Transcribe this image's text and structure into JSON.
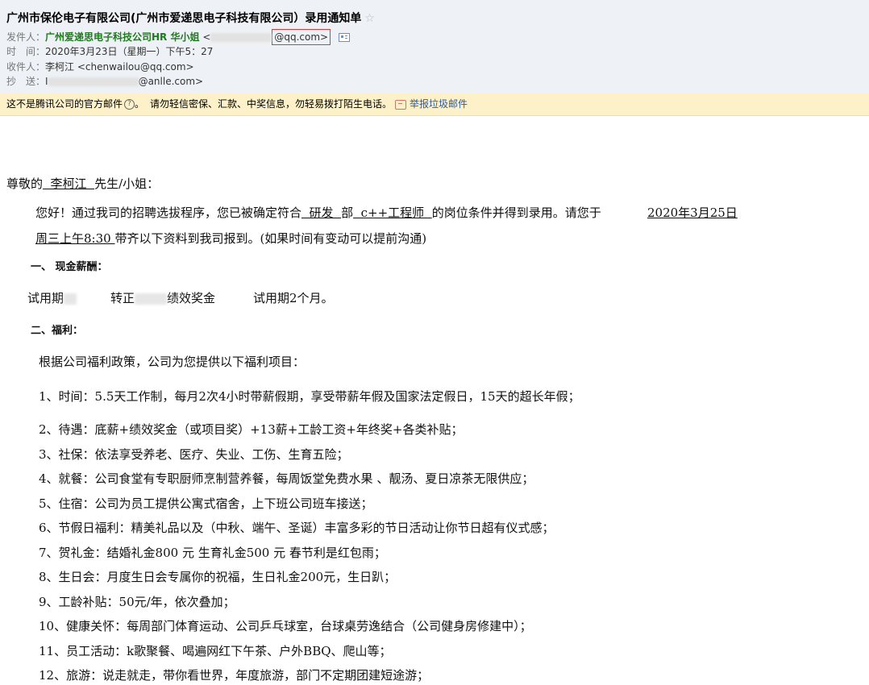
{
  "header": {
    "subject": "广州市保伦电子有限公司(广州市爱递思电子科技有限公司）录用通知单",
    "from_label": "发件人：",
    "from_name": "广州爱递思电子科技公司HR 华小姐",
    "from_email_open": "<",
    "from_email_domain": "@qq.com>",
    "time_label": "时　间：",
    "time_value": "2020年3月23日（星期一）下午5：27",
    "to_label": "收件人：",
    "to_value": "李柯江 <chenwailou@qq.com>",
    "cc_label": "抄　送：",
    "cc_prefix": "I",
    "cc_suffix": "@anlle.com>"
  },
  "warning": {
    "not_official": "这不是腾讯公司的官方邮件",
    "caution": "请勿轻信密保、汇款、中奖信息，勿轻易拨打陌生电话。",
    "report": "举报垃圾邮件"
  },
  "body": {
    "greeting_pre": "尊敬的",
    "greeting_name": "  李柯江  ",
    "greeting_post": "先生/小姐：",
    "p1_a": "您好！通过我司的招聘选拔程序，您已被确定符合",
    "p1_dept": "  研发  ",
    "p1_b": "部",
    "p1_pos": "  c++工程师  ",
    "p1_c": "的岗位条件并得到录用。请您于",
    "p1_date": "2020年3月25日",
    "p2_time": "周三上午8:30 ",
    "p2_rest": "带齐以下资料到我司报到。(如果时间有变动可以提前沟通)",
    "sec1": "一、 现金薪酬：",
    "salary_probation": "试用期",
    "salary_regular": "转正",
    "salary_bonus": "绩效奖金",
    "salary_period": "试用期2个月。",
    "sec2": "二、福利：",
    "welfare_intro": "根据公司福利政策，公司为您提供以下福利项目：",
    "items": [
      "1、时间：5.5天工作制，每月2次4小时带薪假期，享受带薪年假及国家法定假日，15天的超长年假；",
      "2、待遇：底薪+绩效奖金（或项目奖）+13薪+工龄工资+年终奖+各类补贴；",
      "3、社保：依法享受养老、医疗、失业、工伤、生育五险；",
      "4、就餐：公司食堂有专职厨师烹制营养餐，每周饭堂免费水果 、靓汤、夏日凉茶无限供应；",
      "5、住宿：公司为员工提供公寓式宿舍，上下班公司班车接送；",
      "6、节假日福利：精美礼品以及（中秋、端午、圣诞）丰富多彩的节日活动让你节日超有仪式感；",
      "7、贺礼金：结婚礼金800 元 生育礼金500 元 春节利是红包雨；",
      "8、生日会：月度生日会专属你的祝福，生日礼金200元，生日趴；",
      "9、工龄补贴：50元/年，依次叠加；",
      "10、健康关怀：每周部门体育运动、公司乒乓球室，台球桌劳逸结合（公司健身房修建中）；",
      "11、员工活动：k歌聚餐、喝遍网红下午茶、户外BBQ、爬山等；",
      "12、旅游：说走就走，带你看世界，年度旅游，部门不定期团建短途游；"
    ]
  },
  "colors": {
    "header_bg": "#eef1f5",
    "warning_bg": "#fcf1c8",
    "sender_green": "#1b7c1b",
    "link_blue": "#2b5aa8",
    "highlight_red": "#e33333"
  }
}
